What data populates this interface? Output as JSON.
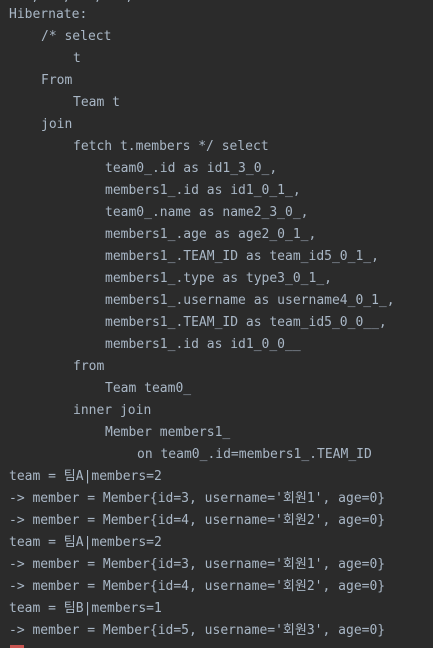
{
  "console": {
    "top_fragment": "    ,   ,   ,   ,   ",
    "lines": [
      {
        "text": "Hibernate:",
        "indent": 0
      },
      {
        "text": "/* select",
        "indent": 1
      },
      {
        "text": "t",
        "indent": 2
      },
      {
        "text": "From",
        "indent": 1
      },
      {
        "text": "Team t",
        "indent": 2
      },
      {
        "text": "join",
        "indent": 1
      },
      {
        "text": "fetch t.members */ select",
        "indent": 2
      },
      {
        "text": "team0_.id as id1_3_0_,",
        "indent": 3
      },
      {
        "text": "members1_.id as id1_0_1_,",
        "indent": 3
      },
      {
        "text": "team0_.name as name2_3_0_,",
        "indent": 3
      },
      {
        "text": "members1_.age as age2_0_1_,",
        "indent": 3
      },
      {
        "text": "members1_.TEAM_ID as team_id5_0_1_,",
        "indent": 3
      },
      {
        "text": "members1_.type as type3_0_1_,",
        "indent": 3
      },
      {
        "text": "members1_.username as username4_0_1_,",
        "indent": 3
      },
      {
        "text": "members1_.TEAM_ID as team_id5_0_0__,",
        "indent": 3
      },
      {
        "text": "members1_.id as id1_0_0__",
        "indent": 3
      },
      {
        "text": "from",
        "indent": 2
      },
      {
        "text": "Team team0_",
        "indent": 3
      },
      {
        "text": "inner join",
        "indent": 2
      },
      {
        "text": "Member members1_",
        "indent": 3
      },
      {
        "text": "on team0_.id=members1_.TEAM_ID",
        "indent": 4
      },
      {
        "text": "team = 팀A|members=2",
        "indent": 0
      },
      {
        "text": "-> member = Member{id=3, username='회원1', age=0}",
        "indent": 0
      },
      {
        "text": "-> member = Member{id=4, username='회원2', age=0}",
        "indent": 0
      },
      {
        "text": "team = 팀A|members=2",
        "indent": 0
      },
      {
        "text": "-> member = Member{id=3, username='회원1', age=0}",
        "indent": 0
      },
      {
        "text": "-> member = Member{id=4, username='회원2', age=0}",
        "indent": 0
      },
      {
        "text": "team = 팀B|members=1",
        "indent": 0
      },
      {
        "text": "-> member = Member{id=5, username='회원3', age=0}",
        "indent": 0
      }
    ]
  },
  "colors": {
    "background": "#2b2b2b",
    "text": "#a9b7c6",
    "error_mark": "#c75450"
  }
}
